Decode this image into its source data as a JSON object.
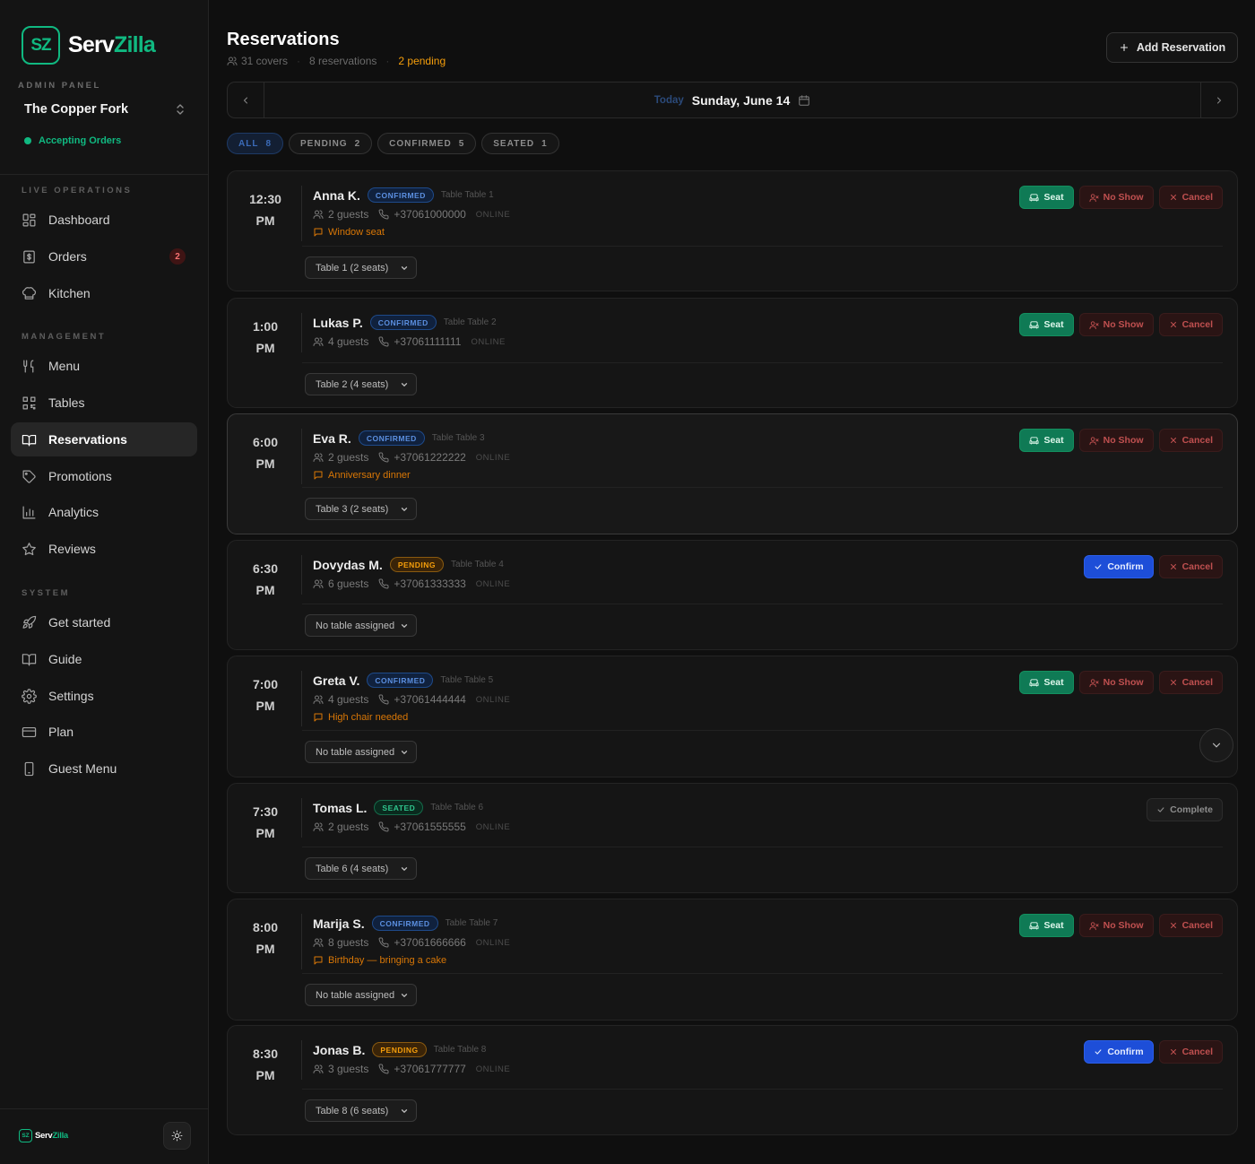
{
  "brand": {
    "logo_text": "SZ",
    "name_a": "Serv",
    "name_b": "Zilla",
    "accent": "#10b981"
  },
  "sidebar": {
    "admin_label": "ADMIN PANEL",
    "venue": "The Copper Fork",
    "status": "Accepting Orders",
    "sections": {
      "live": "LIVE OPERATIONS",
      "management": "MANAGEMENT",
      "system": "SYSTEM"
    },
    "items": [
      {
        "label": "Dashboard",
        "icon": "dashboard-icon"
      },
      {
        "label": "Orders",
        "icon": "orders-icon",
        "badge": "2"
      },
      {
        "label": "Kitchen",
        "icon": "chef-hat-icon"
      },
      {
        "label": "Menu",
        "icon": "utensils-icon"
      },
      {
        "label": "Tables",
        "icon": "qr-code-icon"
      },
      {
        "label": "Reservations",
        "icon": "book-open-icon"
      },
      {
        "label": "Promotions",
        "icon": "tag-icon"
      },
      {
        "label": "Analytics",
        "icon": "bar-chart-icon"
      },
      {
        "label": "Reviews",
        "icon": "star-icon"
      },
      {
        "label": "Get started",
        "icon": "rocket-icon"
      },
      {
        "label": "Guide",
        "icon": "book-icon"
      },
      {
        "label": "Settings",
        "icon": "gear-icon"
      },
      {
        "label": "Plan",
        "icon": "credit-card-icon"
      },
      {
        "label": "Guest Menu",
        "icon": "phone-icon"
      }
    ],
    "active": "Reservations"
  },
  "header": {
    "title": "Reservations",
    "covers": "31 covers",
    "reservations": "8 reservations",
    "pending": "2 pending",
    "add_label": "Add Reservation"
  },
  "datebar": {
    "today": "Today",
    "date": "Sunday, June 14"
  },
  "filters": [
    {
      "label": "ALL",
      "count": "8"
    },
    {
      "label": "PENDING",
      "count": "2"
    },
    {
      "label": "CONFIRMED",
      "count": "5"
    },
    {
      "label": "SEATED",
      "count": "1"
    }
  ],
  "labels": {
    "seat": "Seat",
    "no_show": "No Show",
    "cancel": "Cancel",
    "confirm": "Confirm",
    "complete": "Complete"
  },
  "reservations": [
    {
      "time": "12:30",
      "ampm": "PM",
      "name": "Anna K.",
      "status": "CONFIRMED",
      "table": "Table Table 1",
      "guests": "2 guests",
      "phone": "+37061000000",
      "source": "ONLINE",
      "note": "Window seat",
      "select": "Table 1 (2 seats)"
    },
    {
      "time": "1:00",
      "ampm": "PM",
      "name": "Lukas P.",
      "status": "CONFIRMED",
      "table": "Table Table 2",
      "guests": "4 guests",
      "phone": "+37061111111",
      "source": "ONLINE",
      "note": "",
      "select": "Table 2 (4 seats)"
    },
    {
      "time": "6:00",
      "ampm": "PM",
      "name": "Eva R.",
      "status": "CONFIRMED",
      "table": "Table Table 3",
      "guests": "2 guests",
      "phone": "+37061222222",
      "source": "ONLINE",
      "note": "Anniversary dinner",
      "select": "Table 3 (2 seats)"
    },
    {
      "time": "6:30",
      "ampm": "PM",
      "name": "Dovydas M.",
      "status": "PENDING",
      "table": "Table Table 4",
      "guests": "6 guests",
      "phone": "+37061333333",
      "source": "ONLINE",
      "note": "",
      "select": "No table assigned"
    },
    {
      "time": "7:00",
      "ampm": "PM",
      "name": "Greta V.",
      "status": "CONFIRMED",
      "table": "Table Table 5",
      "guests": "4 guests",
      "phone": "+37061444444",
      "source": "ONLINE",
      "note": "High chair needed",
      "select": "No table assigned"
    },
    {
      "time": "7:30",
      "ampm": "PM",
      "name": "Tomas L.",
      "status": "SEATED",
      "table": "Table Table 6",
      "guests": "2 guests",
      "phone": "+37061555555",
      "source": "ONLINE",
      "note": "",
      "select": "Table 6 (4 seats)"
    },
    {
      "time": "8:00",
      "ampm": "PM",
      "name": "Marija S.",
      "status": "CONFIRMED",
      "table": "Table Table 7",
      "guests": "8 guests",
      "phone": "+37061666666",
      "source": "ONLINE",
      "note": "Birthday — bringing a cake",
      "select": "No table assigned"
    },
    {
      "time": "8:30",
      "ampm": "PM",
      "name": "Jonas B.",
      "status": "PENDING",
      "table": "Table Table 8",
      "guests": "3 guests",
      "phone": "+37061777777",
      "source": "ONLINE",
      "note": "",
      "select": "Table 8 (6 seats)"
    }
  ]
}
